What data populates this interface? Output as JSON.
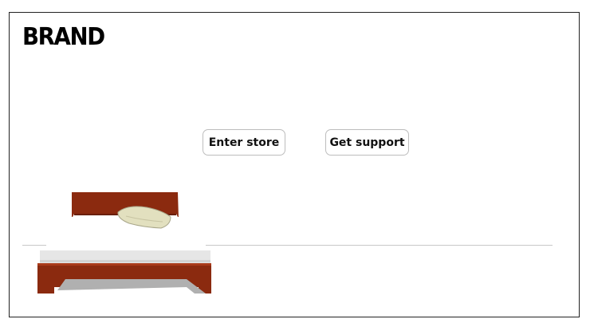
{
  "brand": {
    "title": "BRAND"
  },
  "actions": {
    "enter_store_label": "Enter store",
    "get_support_label": "Get support"
  },
  "hero": {
    "illustration": "bed-illustration",
    "colors": {
      "frame_wood": "#8b2a0f",
      "mattress": "#e6e6e6",
      "pillow": "#e2e0bf",
      "shadow": "#b0b0b0",
      "floor_line": "#c8c8c8"
    }
  }
}
